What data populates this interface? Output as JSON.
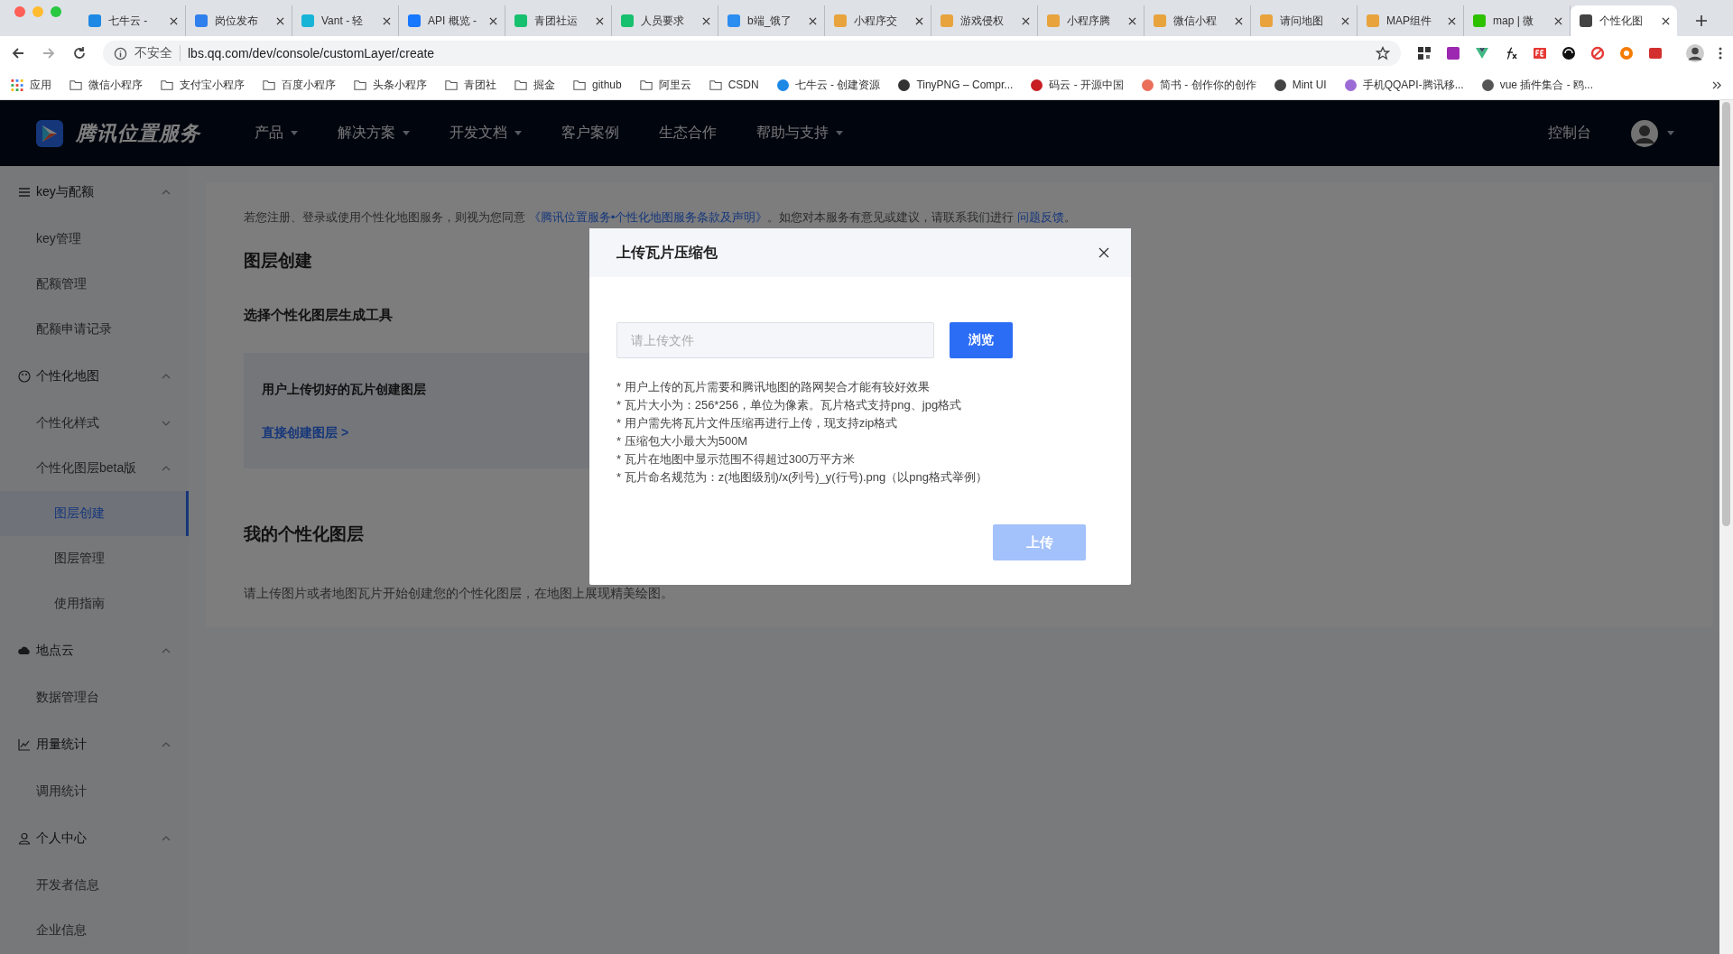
{
  "browser": {
    "tabs": [
      {
        "title": "七牛云 -",
        "selected": false,
        "color": "#1e88e5"
      },
      {
        "title": "岗位发布",
        "selected": false,
        "color": "#2f80ed"
      },
      {
        "title": "Vant - 轻",
        "selected": false,
        "color": "#18b4d8"
      },
      {
        "title": "API 概览 -",
        "selected": false,
        "color": "#1677ff"
      },
      {
        "title": "青团社运",
        "selected": false,
        "color": "#16c06e"
      },
      {
        "title": "人员要求",
        "selected": false,
        "color": "#16c06e"
      },
      {
        "title": "b端_饿了",
        "selected": false,
        "color": "#2a8df0"
      },
      {
        "title": "小程序交",
        "selected": false,
        "color": "#e8a33c"
      },
      {
        "title": "游戏侵权",
        "selected": false,
        "color": "#e8a33c"
      },
      {
        "title": "小程序腾",
        "selected": false,
        "color": "#e8a33c"
      },
      {
        "title": "微信小程",
        "selected": false,
        "color": "#e8a33c"
      },
      {
        "title": "请问地图",
        "selected": false,
        "color": "#e8a33c"
      },
      {
        "title": "MAP组件",
        "selected": false,
        "color": "#e8a33c"
      },
      {
        "title": "map | 微",
        "selected": false,
        "color": "#2dc100"
      },
      {
        "title": "个性化图",
        "selected": true,
        "color": "#444444"
      }
    ],
    "address": {
      "security": "不安全",
      "url": "lbs.qq.com/dev/console/customLayer/create"
    },
    "bookmarks": [
      {
        "label": "应用",
        "kind": "apps"
      },
      {
        "label": "微信小程序",
        "kind": "folder"
      },
      {
        "label": "支付宝小程序",
        "kind": "folder"
      },
      {
        "label": "百度小程序",
        "kind": "folder"
      },
      {
        "label": "头条小程序",
        "kind": "folder"
      },
      {
        "label": "青团社",
        "kind": "folder"
      },
      {
        "label": "掘金",
        "kind": "folder"
      },
      {
        "label": "github",
        "kind": "folder"
      },
      {
        "label": "阿里云",
        "kind": "folder"
      },
      {
        "label": "CSDN",
        "kind": "folder"
      },
      {
        "label": "七牛云 - 创建资源",
        "kind": "site",
        "color": "#1e88e5"
      },
      {
        "label": "TinyPNG – Compr...",
        "kind": "site",
        "color": "#333333"
      },
      {
        "label": "码云 - 开源中国",
        "kind": "site",
        "color": "#c71d23"
      },
      {
        "label": "简书 - 创作你的创作",
        "kind": "site",
        "color": "#ea6f5a"
      },
      {
        "label": "Mint UI",
        "kind": "site",
        "color": "#444444"
      },
      {
        "label": "手机QQAPI-腾讯移...",
        "kind": "site",
        "color": "#9b6bd6"
      },
      {
        "label": "vue 插件集合 - 鸥...",
        "kind": "site",
        "color": "#555555"
      }
    ]
  },
  "header": {
    "logo": "腾讯位置服务",
    "nav": [
      {
        "label": "产品",
        "has_menu": true
      },
      {
        "label": "解决方案",
        "has_menu": true
      },
      {
        "label": "开发文档",
        "has_menu": true
      },
      {
        "label": "客户案例",
        "has_menu": false
      },
      {
        "label": "生态合作",
        "has_menu": false
      },
      {
        "label": "帮助与支持",
        "has_menu": true
      }
    ],
    "console": "控制台"
  },
  "sidebar": {
    "groups": [
      {
        "label": "key与配额",
        "expanded": true,
        "children": [
          {
            "label": "key管理",
            "selected": false
          },
          {
            "label": "配额管理",
            "selected": false
          },
          {
            "label": "配额申请记录",
            "selected": false
          }
        ]
      },
      {
        "label": "个性化地图",
        "expanded": true,
        "children": [
          {
            "label": "个性化样式",
            "expanded": false,
            "selected": false
          },
          {
            "label": "个性化图层beta版",
            "expanded": true,
            "selected": false,
            "children": [
              {
                "label": "图层创建",
                "selected": true
              },
              {
                "label": "图层管理",
                "selected": false
              },
              {
                "label": "使用指南",
                "selected": false
              }
            ]
          }
        ]
      },
      {
        "label": "地点云",
        "expanded": true,
        "children": [
          {
            "label": "数据管理台",
            "selected": false
          }
        ]
      },
      {
        "label": "用量统计",
        "expanded": true,
        "children": [
          {
            "label": "调用统计",
            "selected": false
          }
        ]
      },
      {
        "label": "个人中心",
        "expanded": true,
        "children": [
          {
            "label": "开发者信息",
            "selected": false
          },
          {
            "label": "企业信息",
            "selected": false
          }
        ]
      }
    ]
  },
  "content": {
    "notice": [
      {
        "kind": "text",
        "text": "若您注册、登录或使用个性化地图服务，则视为您同意 "
      },
      {
        "kind": "link",
        "text": "《腾讯位置服务•个性化地图服务条款及声明》"
      },
      {
        "kind": "text",
        "text": "。如您对本服务有意见或建议，请联系我们进行 "
      },
      {
        "kind": "link",
        "text": "问题反馈"
      },
      {
        "kind": "text",
        "text": "。"
      }
    ],
    "title": "图层创建",
    "subtitle": "选择个性化图层生成工具",
    "tool_card": {
      "title": "用户上传切好的瓦片创建图层",
      "link": "直接创建图层 >"
    },
    "my_layers": {
      "title": "我的个性化图层",
      "hint": "请上传图片或者地图瓦片开始创建您的个性化图层，在地图上展现精美绘图。"
    }
  },
  "modal": {
    "title": "上传瓦片压缩包",
    "file_field": {
      "placeholder": "请上传文件"
    },
    "browse_button": "浏览",
    "notes": [
      "* 用户上传的瓦片需要和腾讯地图的路网契合才能有较好效果",
      "* 瓦片大小为：256*256，单位为像素。瓦片格式支持png、jpg格式",
      "* 用户需先将瓦片文件压缩再进行上传，现支持zip格式",
      "* 压缩包大小最大为500M",
      "* 瓦片在地图中显示范围不得超过300万平方米",
      "* 瓦片命名规范为：z(地图级别)/x(列号)_y(行号).png（以png格式举例）"
    ],
    "upload_button": {
      "label": "上传",
      "disabled": true
    }
  }
}
